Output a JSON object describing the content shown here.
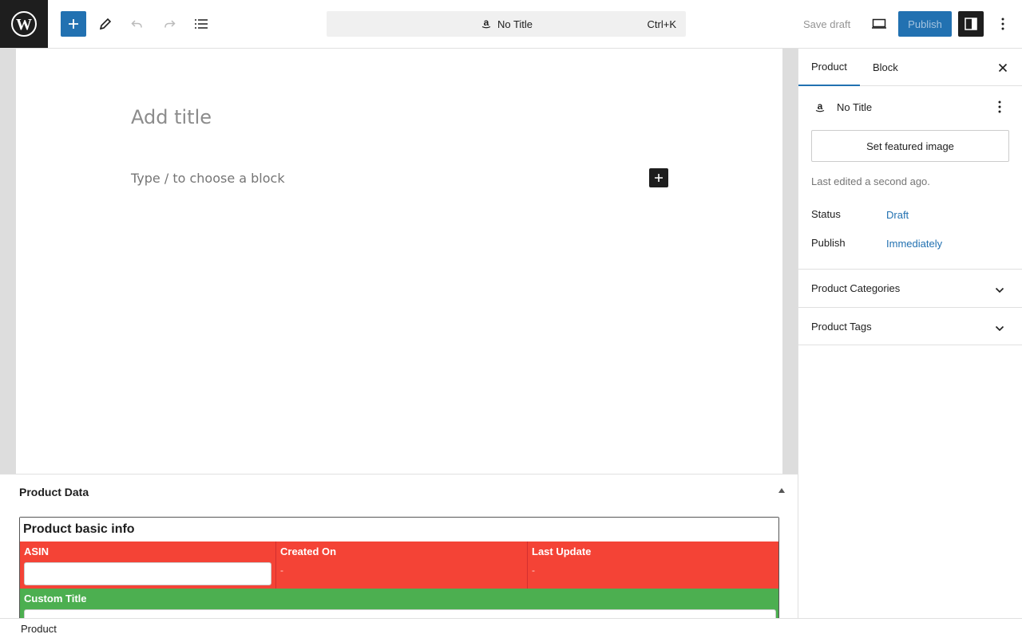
{
  "toolbar": {
    "command_bar_title": "No Title",
    "command_shortcut": "Ctrl+K",
    "save_draft_label": "Save draft",
    "publish_label": "Publish"
  },
  "editor": {
    "title_placeholder": "Add title",
    "block_placeholder": "Type / to choose a block"
  },
  "metabox": {
    "header": "Product Data",
    "section_title": "Product basic info",
    "columns": [
      {
        "label": "ASIN",
        "value": ""
      },
      {
        "label": "Created On",
        "value": "-"
      },
      {
        "label": "Last Update",
        "value": "-"
      }
    ],
    "custom_title_label": "Custom Title",
    "colors": {
      "red": "#f44336",
      "green": "#4caf50"
    }
  },
  "sidebar": {
    "tabs": [
      {
        "label": "Product",
        "active": true
      },
      {
        "label": "Block",
        "active": false
      }
    ],
    "post_title": "No Title",
    "featured_image_label": "Set featured image",
    "last_edited": "Last edited a second ago.",
    "status_label": "Status",
    "status_value": "Draft",
    "publish_label": "Publish",
    "publish_value": "Immediately",
    "panels": [
      {
        "label": "Product Categories"
      },
      {
        "label": "Product Tags"
      }
    ]
  },
  "footer": {
    "breadcrumb": "Product"
  },
  "colors": {
    "accent": "#2271b1",
    "dark": "#1e1e1e"
  }
}
